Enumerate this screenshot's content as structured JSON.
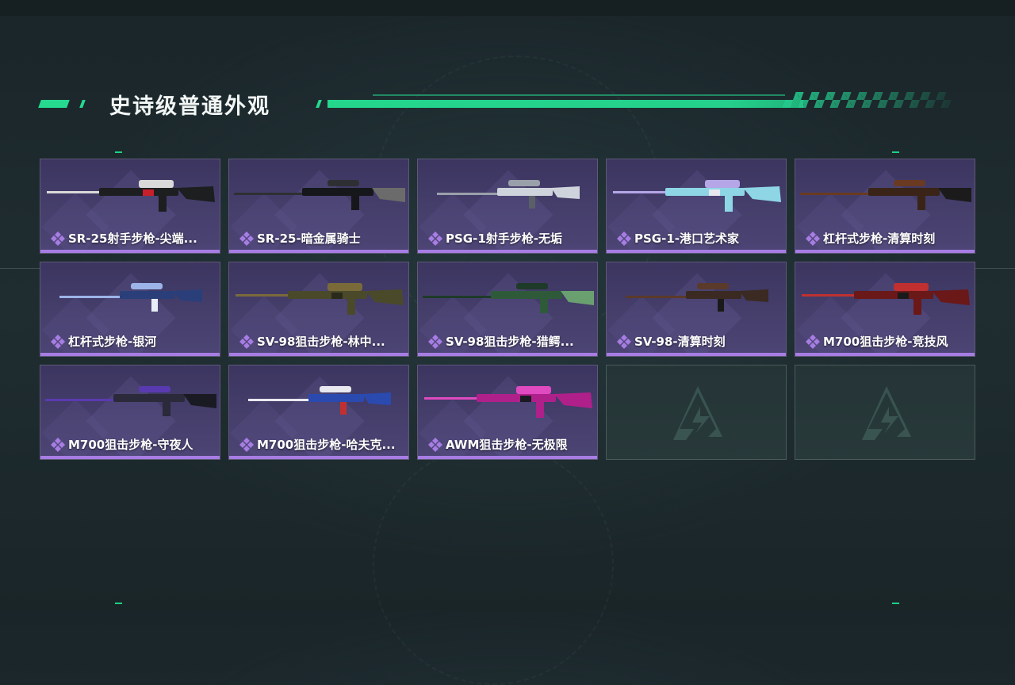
{
  "section": {
    "title": "史诗级普通外观"
  },
  "colors": {
    "accent": "#25d98f",
    "rarity": "#a77de4",
    "card_bg": "#433c69",
    "empty_bg": "#27383a"
  },
  "items": [
    {
      "name": "SR-25射手步枪-尖端...",
      "icon": "rarity-epic-icon",
      "palette": [
        "#1c1e20",
        "#d9d9d9",
        "#c8202b"
      ]
    },
    {
      "name": "SR-25-暗金属骑士",
      "icon": "rarity-epic-icon",
      "palette": [
        "#15171a",
        "#2e2f33",
        "#6b6b6b"
      ]
    },
    {
      "name": "PSG-1射手步枪-无垢",
      "icon": "rarity-epic-icon",
      "palette": [
        "#cfd4dc",
        "#9aa0aa",
        "#5a5f68"
      ]
    },
    {
      "name": "PSG-1-港口艺术家",
      "icon": "rarity-epic-icon",
      "palette": [
        "#8ed6e6",
        "#b5a6e8",
        "#e8e8f0"
      ]
    },
    {
      "name": "杠杆式步枪-清算时刻",
      "icon": "rarity-epic-icon",
      "palette": [
        "#3a2418",
        "#6b3a22",
        "#1b1b1b"
      ]
    },
    {
      "name": "杠杆式步枪-银河",
      "icon": "rarity-epic-icon",
      "palette": [
        "#2a3f7a",
        "#9db4e8",
        "#e8eef8"
      ]
    },
    {
      "name": "SV-98狙击步枪-林中...",
      "icon": "rarity-epic-icon",
      "palette": [
        "#4a4a2a",
        "#7a6a3a",
        "#2a2a1a"
      ]
    },
    {
      "name": "SV-98狙击步枪-猎鳄...",
      "icon": "rarity-epic-icon",
      "palette": [
        "#2e5a3a",
        "#1e3a28",
        "#6aa070"
      ]
    },
    {
      "name": "SV-98-清算时刻",
      "icon": "rarity-epic-icon",
      "palette": [
        "#3a2a22",
        "#5a3a2a",
        "#1a1a1a"
      ]
    },
    {
      "name": "M700狙击步枪-竞技风",
      "icon": "rarity-epic-icon",
      "palette": [
        "#6a1818",
        "#c03030",
        "#1a1a1a"
      ]
    },
    {
      "name": "M700狙击步枪-守夜人",
      "icon": "rarity-epic-icon",
      "palette": [
        "#2a2a3a",
        "#5a3ab0",
        "#1a1a22"
      ]
    },
    {
      "name": "M700狙击步枪-哈夫克...",
      "icon": "rarity-epic-icon",
      "palette": [
        "#2a4ab0",
        "#e8e8f0",
        "#c03030"
      ]
    },
    {
      "name": "AWM狙击步枪-无极限",
      "icon": "rarity-epic-icon",
      "palette": [
        "#b0208a",
        "#e04ac0",
        "#1a1a22"
      ]
    }
  ],
  "empty_slots": [
    {
      "icon": "delta-logo-icon"
    },
    {
      "icon": "delta-logo-icon"
    }
  ]
}
